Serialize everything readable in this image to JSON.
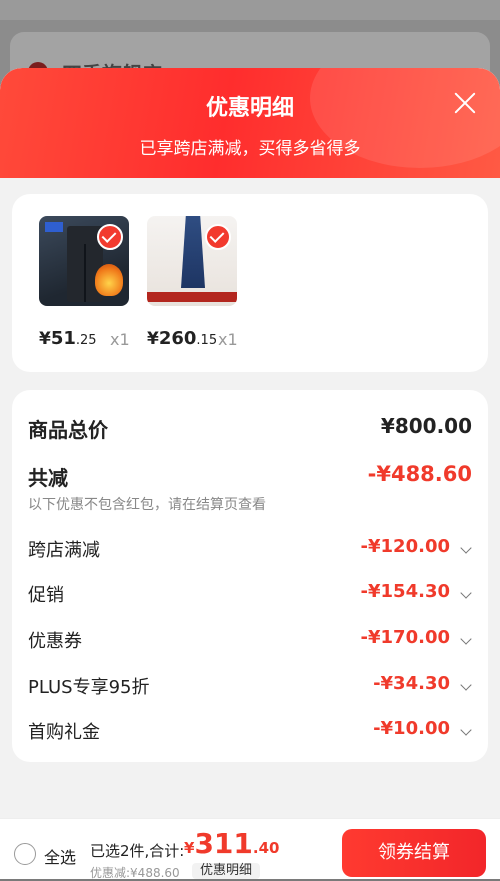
{
  "background": {
    "store_name": "四季旗舰店"
  },
  "sheet": {
    "title": "优惠明细",
    "subtitle": "已享跨店满减，买得多省得多"
  },
  "products": [
    {
      "price_prefix": "¥",
      "price_int": "51",
      "price_dec": ".25",
      "qty": "x1",
      "checked": true
    },
    {
      "price_prefix": "¥",
      "price_int": "260",
      "price_dec": ".15",
      "qty": "x1",
      "checked": true
    }
  ],
  "summary": {
    "total_label": "商品总价",
    "total_value": "¥800.00",
    "discount_label": "共减",
    "discount_value": "-¥488.60",
    "note": "以下优惠不包含红包，请在结算页查看",
    "items": [
      {
        "label": "跨店满减",
        "value": "-¥120.00"
      },
      {
        "label": "促销",
        "value": "-¥154.30"
      },
      {
        "label": "优惠券",
        "value": "-¥170.00"
      },
      {
        "label": "PLUS专享95折",
        "value": "-¥34.30"
      },
      {
        "label": "首购礼金",
        "value": "-¥10.00"
      }
    ]
  },
  "bottom_bar": {
    "select_all": "全选",
    "selected_info": "已选2件,合计:",
    "total_yen": "¥",
    "total_int": "311",
    "total_dec": ".40",
    "discount_line": "优惠减:¥488.60",
    "detail_chip": "优惠明细",
    "checkout_label": "领券结算"
  },
  "colors": {
    "accent": "#f03a2b",
    "header_red": "#ff2d2d"
  }
}
